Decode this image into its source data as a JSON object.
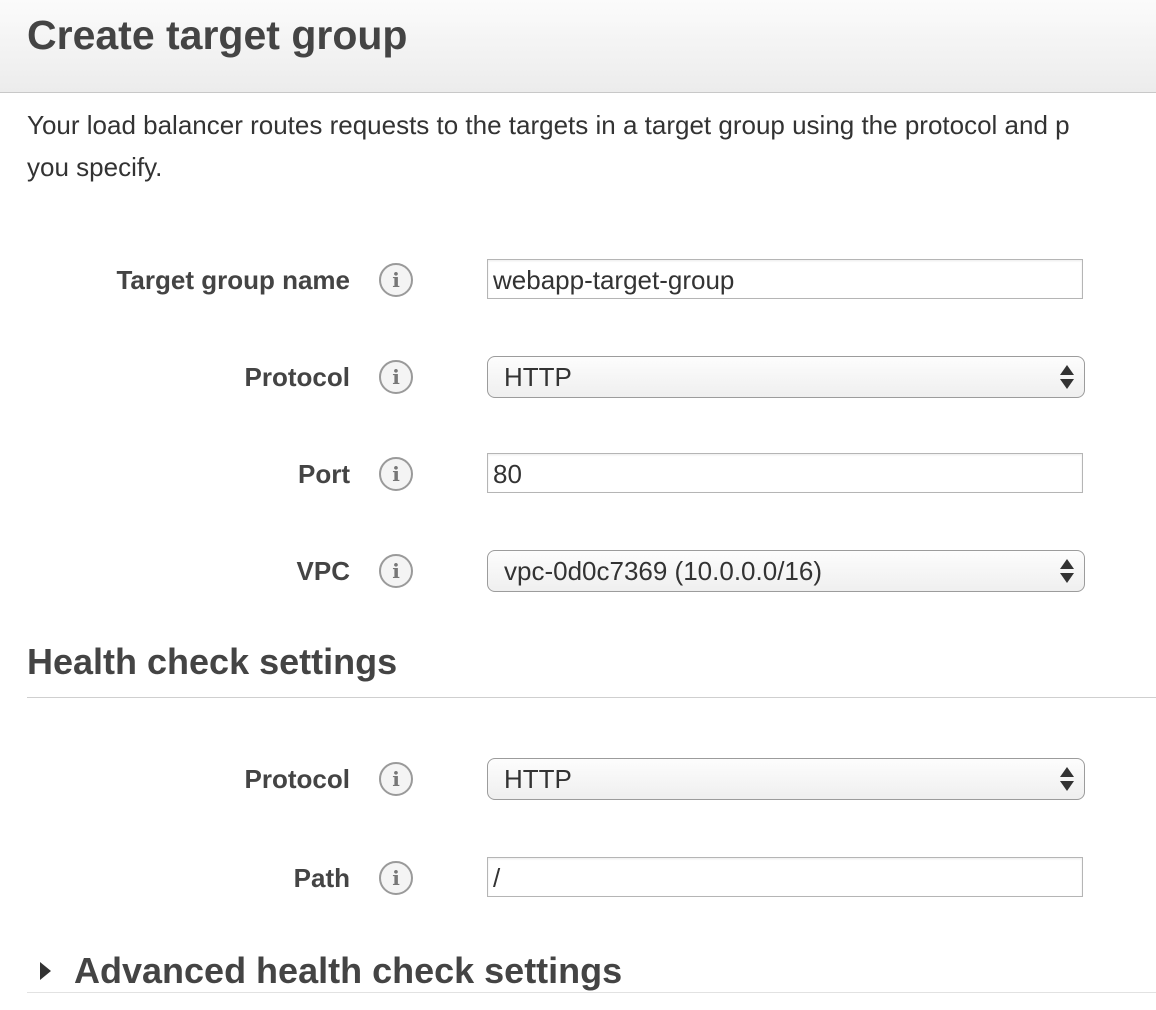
{
  "header": {
    "title": "Create target group"
  },
  "intro": {
    "line1": "Your load balancer routes requests to the targets in a target group using the protocol and p",
    "line2": "you specify."
  },
  "target_group": {
    "name": {
      "label": "Target group name",
      "value": "webapp-target-group"
    },
    "protocol": {
      "label": "Protocol",
      "value": "HTTP"
    },
    "port": {
      "label": "Port",
      "value": "80"
    },
    "vpc": {
      "label": "VPC",
      "value": "vpc-0d0c7369 (10.0.0.0/16)"
    }
  },
  "health_check": {
    "title": "Health check settings",
    "protocol": {
      "label": "Protocol",
      "value": "HTTP"
    },
    "path": {
      "label": "Path",
      "value": "/"
    }
  },
  "advanced": {
    "title": "Advanced health check settings"
  },
  "icons": {
    "info": "info-icon",
    "expand": "caret-right-icon",
    "select": "up-down-chevron-icon"
  }
}
